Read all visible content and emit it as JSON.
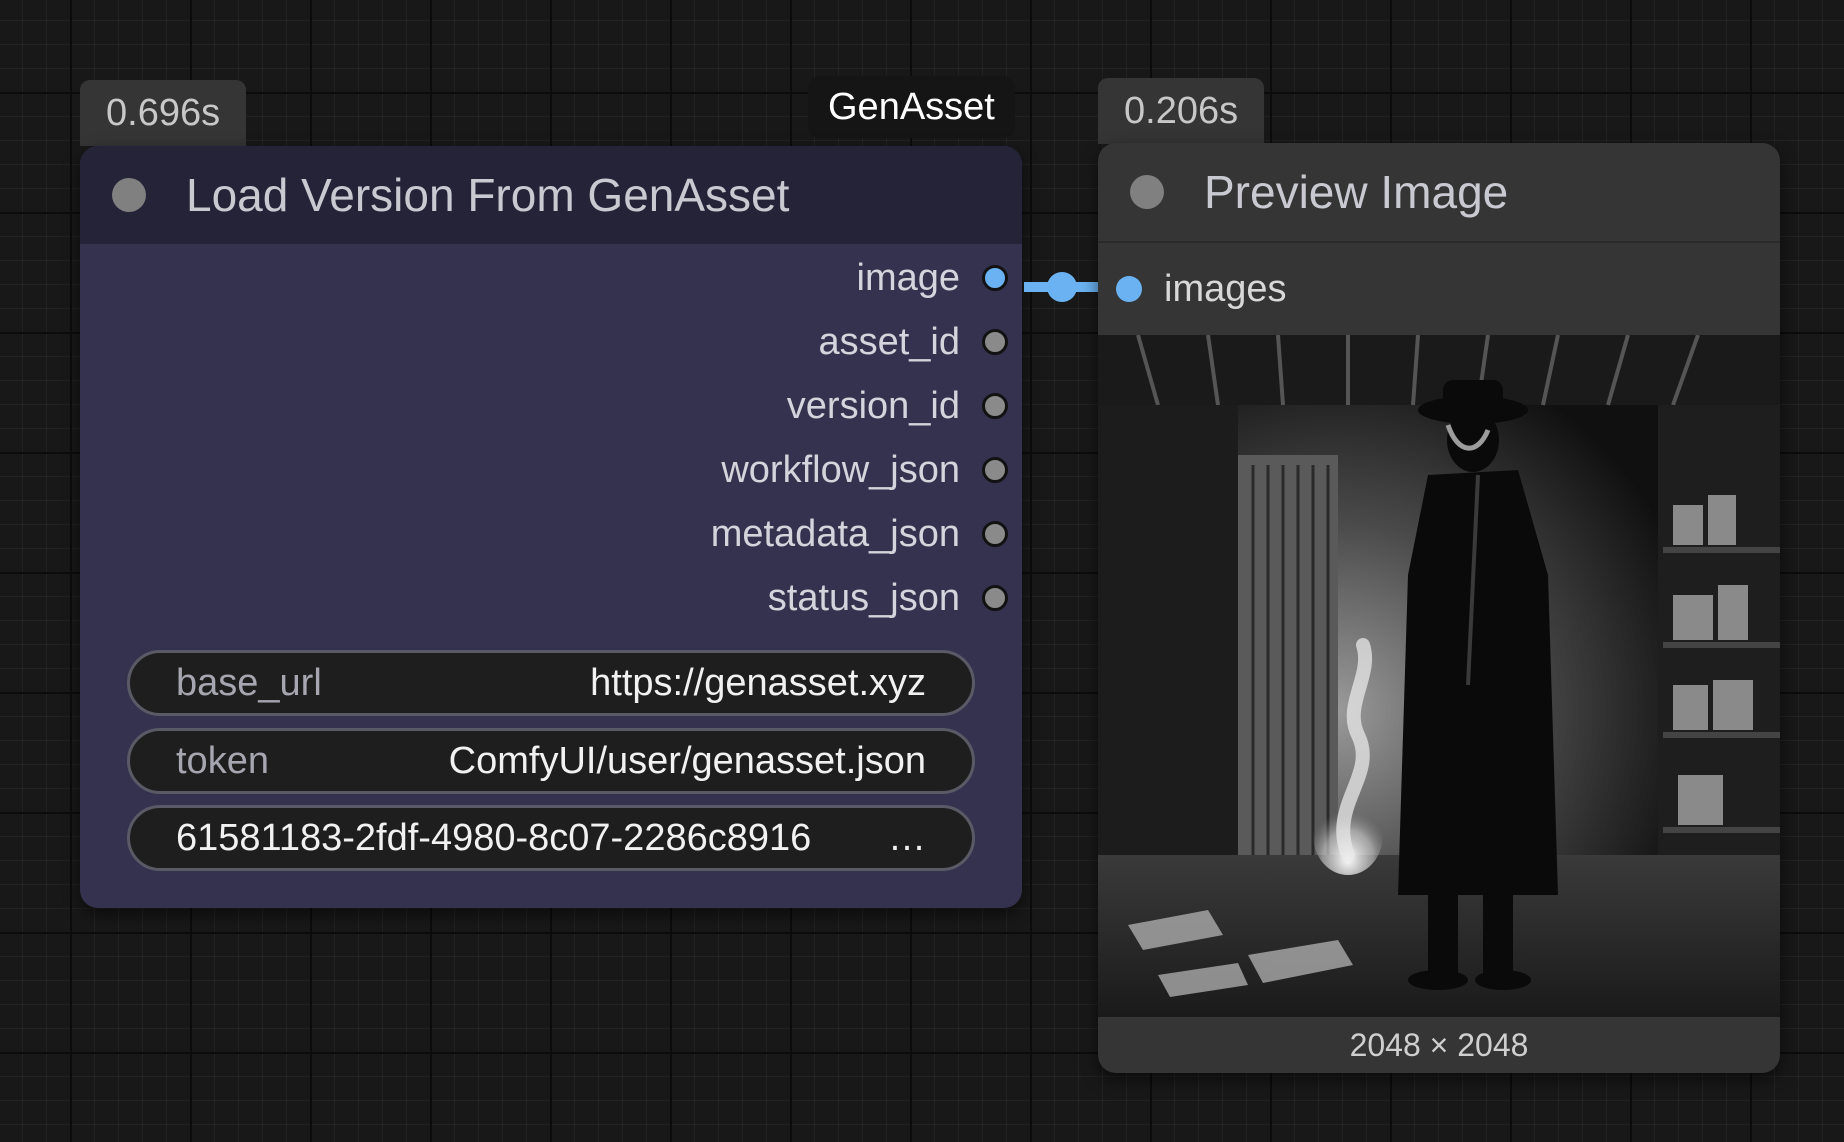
{
  "group": {
    "title": "GenAsset"
  },
  "load_node": {
    "time": "0.696s",
    "title": "Load Version From GenAsset",
    "outputs": [
      "image",
      "asset_id",
      "version_id",
      "workflow_json",
      "metadata_json",
      "status_json"
    ],
    "widgets": {
      "base_url": {
        "label": "base_url",
        "value": "https://genasset.xyz"
      },
      "token": {
        "label": "token",
        "value": "ComfyUI/user/genasset.json"
      },
      "version": {
        "value": "61581183-2fdf-4980-8c07-2286c8916",
        "ellipsis": "…"
      }
    }
  },
  "preview_node": {
    "time": "0.206s",
    "title": "Preview Image",
    "input_label": "images",
    "dimensions": "2048 × 2048"
  },
  "colors": {
    "link": "#6bb2f2",
    "load_body": "#34324f",
    "load_header": "#252338",
    "preview_body": "#353535"
  }
}
